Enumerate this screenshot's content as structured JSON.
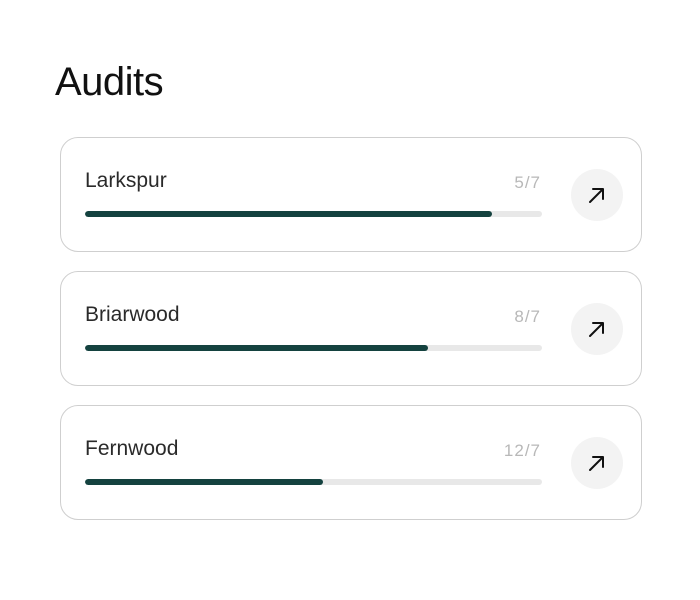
{
  "page": {
    "title": "Audits"
  },
  "audits": [
    {
      "name": "Larkspur",
      "count": "5/7",
      "progress": 0.89
    },
    {
      "name": "Briarwood",
      "count": "8/7",
      "progress": 0.75
    },
    {
      "name": "Fernwood",
      "count": "12/7",
      "progress": 0.52
    }
  ],
  "icons": {
    "open": "arrow-up-right-icon"
  },
  "colors": {
    "progress_fill": "#14423f",
    "progress_track": "#e8e8e8",
    "count_text": "#b8b8b8"
  }
}
